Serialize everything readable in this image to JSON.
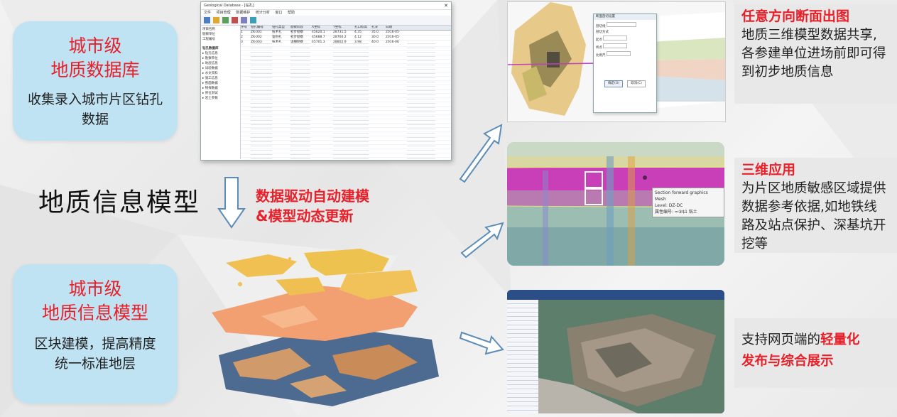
{
  "left_top_card": {
    "title_line1": "城市级",
    "title_line2": "地质数据库",
    "desc": "收集录入城市片区钻孔数据"
  },
  "center_title": "地质信息模型",
  "process_text_line1": "数据驱动自动建模",
  "process_text_line2": "&模型动态更新",
  "left_bottom_card": {
    "title_line1": "城市级",
    "title_line2": "地质信息模型",
    "desc_line1": "区块建模，提高精度",
    "desc_line2": "统一标准地层"
  },
  "db_window": {
    "title": "Geological Database - [钻孔]",
    "menu": [
      "文件",
      "项目管理",
      "数据维护",
      "统计分析",
      "窗口",
      "帮助"
    ],
    "tree_root": "钻孔数据库",
    "tree_items": [
      "钻孔信息",
      "勘察单位",
      "地层信息",
      "试验数据",
      "水文资料",
      "施工信息",
      "剖面数据",
      "物探数据",
      "原位测试",
      "岩土参数"
    ],
    "left_fields": [
      "项目名称",
      "勘察单位",
      "工程编号"
    ],
    "columns": [
      "序号",
      "钻孔编号",
      "钻孔类型",
      "勘察阶段",
      "X坐标",
      "Y坐标",
      "孔口标高",
      "孔深",
      "日期"
    ],
    "sample_rows": [
      [
        "1",
        "ZK-001",
        "技术孔",
        "初步勘察",
        "45620.1",
        "28731.5",
        "4.35",
        "35.0",
        "2016-05"
      ],
      [
        "2",
        "ZK-002",
        "鉴别孔",
        "初步勘察",
        "45688.7",
        "28760.2",
        "4.12",
        "30.0",
        "2016-05"
      ],
      [
        "3",
        "ZK-003",
        "技术孔",
        "详细勘察",
        "45701.3",
        "28802.9",
        "3.98",
        "40.0",
        "2016-06"
      ]
    ]
  },
  "panel1": {
    "title": "任意方向断面出图",
    "text": "地质三维模型数据共享,各参建单位进场前即可得到初步地质信息"
  },
  "panel2": {
    "title": "三维应用",
    "text": "为片区地质敏感区域提供数据参考依据,如地铁线路及站点保护、深基坑开挖等"
  },
  "panel3": {
    "text_prefix": "支持网页端的",
    "text_red1": "轻量化",
    "text_red2": "发布与综合展示"
  },
  "section_dialog": {
    "title": "断面剖切设置",
    "rows": [
      "剖切线",
      "剖切方式",
      "起点",
      "终点",
      "比例尺"
    ],
    "ok_label": "确定(O)",
    "cancel_label": "取消(C)"
  },
  "tooltip": {
    "line1": "Section forward graphics",
    "line2": "Mesh",
    "line3": "Level: DZ-DC",
    "line4": "属性编号: =③$1 粘土"
  },
  "colors": {
    "accent_red": "#e8202a",
    "card_blue": "#bfe3f2",
    "panel_gray": "#e8e8e8"
  }
}
